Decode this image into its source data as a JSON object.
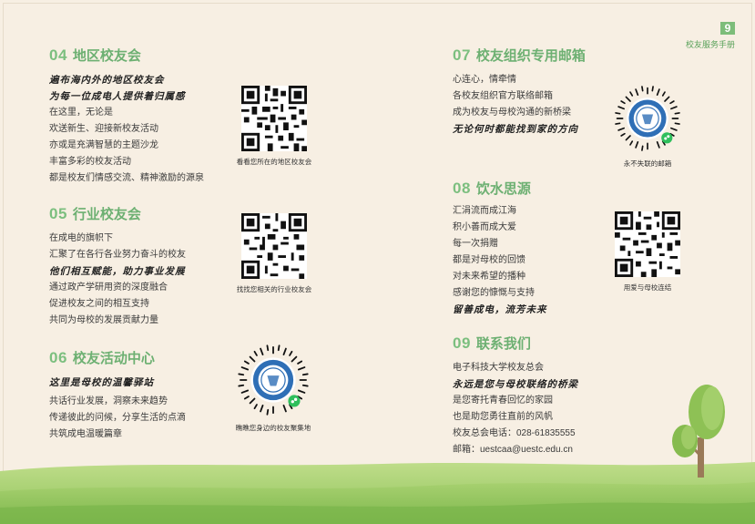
{
  "page_tag": {
    "number": "9",
    "label": "校友服务手册"
  },
  "sections": {
    "s04": {
      "num": "04",
      "title": "地区校友会",
      "slogan1": "遍布海内外的地区校友会",
      "slogan2": "为每一位成电人提供着归属感",
      "lines": [
        "在这里，无论是",
        "欢送新生、迎接新校友活动",
        "亦或是充满智慧的主题沙龙",
        "丰富多彩的校友活动",
        "都是校友们情感交流、精神激励的源泉"
      ],
      "qr_caption": "看看您所在的地区校友会"
    },
    "s05": {
      "num": "05",
      "title": "行业校友会",
      "line1": "在成电的旗帜下",
      "line2": "汇聚了在各行各业努力奋斗的校友",
      "slogan": "他们相互赋能，助力事业发展",
      "line3": "通过政产学研用资的深度融合",
      "line4": "促进校友之间的相互支持",
      "line5": "共同为母校的发展贡献力量",
      "qr_caption": "找找您相关的行业校友会"
    },
    "s06": {
      "num": "06",
      "title": "校友活动中心",
      "slogan": "这里是母校的温馨驿站",
      "lines": [
        "共话行业发展，洞察未来趋势",
        "传递彼此的问候，分享生活的点滴",
        "共筑成电温暖篇章"
      ],
      "qr_caption": "瞧瞧您身边的校友聚集地"
    },
    "s07": {
      "num": "07",
      "title": "校友组织专用邮箱",
      "lines": [
        "心连心，情牵情",
        "各校友组织官方联络邮箱",
        "成为校友与母校沟通的新桥梁"
      ],
      "slogan": "无论何时都能找到家的方向",
      "qr_caption": "永不失联的邮箱"
    },
    "s08": {
      "num": "08",
      "title": "饮水思源",
      "lines": [
        "汇涓流而成江海",
        "积小善而成大爱",
        "每一次捐赠",
        "都是对母校的回馈",
        "对未来希望的播种",
        "感谢您的慷慨与支持"
      ],
      "slogan": "留善成电，流芳未来",
      "qr_caption": "用爱与母校连结"
    },
    "s09": {
      "num": "09",
      "title": "联系我们",
      "org": "电子科技大学校友总会",
      "slogan": "永远是您与母校联络的桥梁",
      "line1": "是您寄托青春回忆的家园",
      "line2": "也是助您勇往直前的风帆",
      "phone": "校友总会电话：028-61835555",
      "email": "邮箱：uestcaa@uestc.edu.cn"
    }
  },
  "colors": {
    "accent": "#6db072",
    "background": "#f7efe3"
  }
}
